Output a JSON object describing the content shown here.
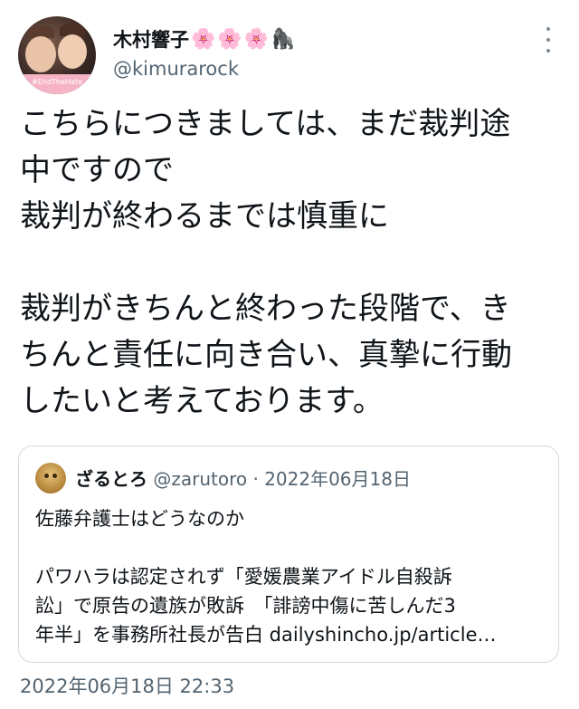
{
  "tweet": {
    "author_name": "木村響子",
    "author_emoji": [
      "🌸",
      "🌸",
      "🌸",
      "🦍"
    ],
    "handle": "@kimurarock",
    "avatar_banner": "#EndTheHate",
    "text": "こちらにつきましては、まだ裁判途\n中ですので\n裁判が終わるまでは慎重に\n\n裁判がきちんと終わった段階で、き\nちんと責任に向き合い、真摯に行動\nしたいと考えております。",
    "timestamp": "2022年06月18日 22:33"
  },
  "quote": {
    "name": "ざるとろ",
    "handle": "@zarutoro",
    "separator": "·",
    "date": "2022年06月18日",
    "text": "佐藤弁護士はどうなのか\n\nパワハラは認定されず「愛媛農業アイドル自殺訴\n訟」で原告の遺族が敗訴　「誹謗中傷に苦しんだ3\n年半」を事務所社長が告白 dailyshincho.jp/article…"
  },
  "icons": {
    "more": "more-options-icon"
  }
}
